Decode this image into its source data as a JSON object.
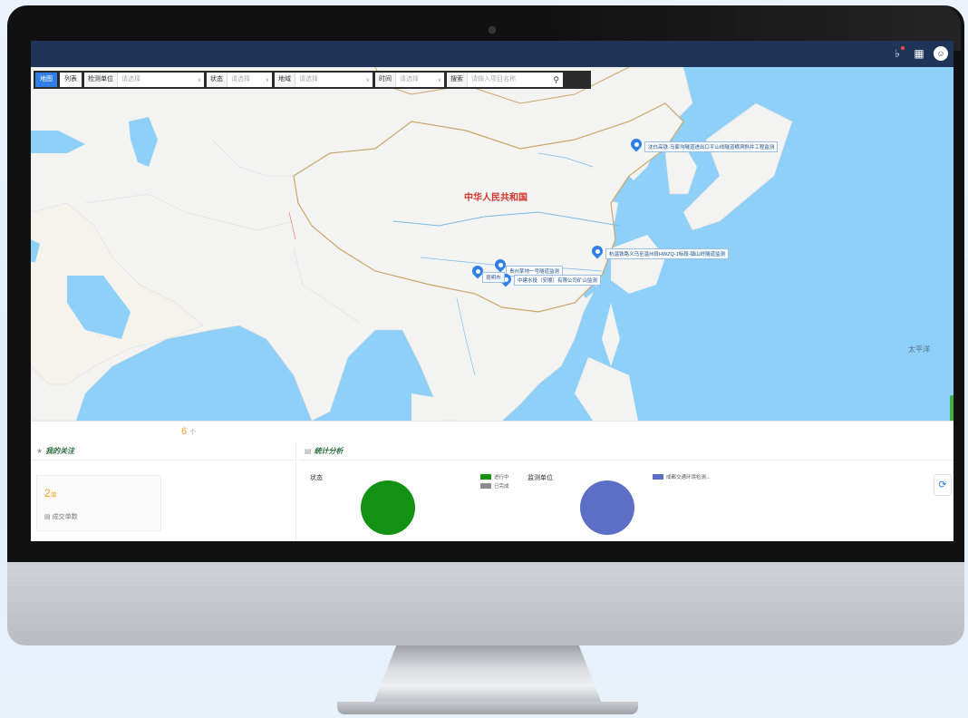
{
  "topbar": {
    "icons": [
      "bell-icon",
      "grid-icon",
      "user-icon"
    ]
  },
  "filters": {
    "tabs": [
      {
        "label": "地图",
        "active": true
      },
      {
        "label": "列表",
        "active": false
      }
    ],
    "unit": {
      "label": "检测单位",
      "placeholder": "请选择"
    },
    "status": {
      "label": "状态",
      "placeholder": "请选择"
    },
    "region": {
      "label": "地域",
      "placeholder": "请选择"
    },
    "time": {
      "label": "时间",
      "placeholder": "请选择"
    },
    "search": {
      "label": "搜索",
      "placeholder": "请输入项目名称"
    }
  },
  "map": {
    "country_label": "中华人民共和国",
    "ocean_label": "太平洋",
    "markers": [
      {
        "label": "沈白高铁-马家沟隧道进出口平山线隧道横洞斜井工程监测",
        "color": "#2f7fe6"
      },
      {
        "label": "杭温铁路义乌至温州段HWZQ-1标段-镇山岭隧道监测",
        "color": "#2f7fe6"
      },
      {
        "label": "贵州某地一号隧道监测",
        "color": "#2f7fe6"
      },
      {
        "label": "中建水投（安顺）有限公司矿山监测",
        "color": "#2f7fe6"
      },
      {
        "label": "昆明市",
        "color": "#2f7fe6"
      }
    ]
  },
  "summary": {
    "count": "6",
    "count_unit": "个"
  },
  "follow": {
    "title": "我的关注",
    "value": "2",
    "unit": "单",
    "desc": "成交单数"
  },
  "stats": {
    "title": "统计分析",
    "status_label": "状态",
    "status_legend": [
      {
        "name": "进行中",
        "color": "#129112"
      },
      {
        "name": "已完成",
        "color": "#8c8c8c"
      }
    ],
    "unit_label": "监测单位",
    "unit_legend": [
      {
        "name": "成都交通环境检测...",
        "color": "#5b6fc7"
      }
    ]
  }
}
